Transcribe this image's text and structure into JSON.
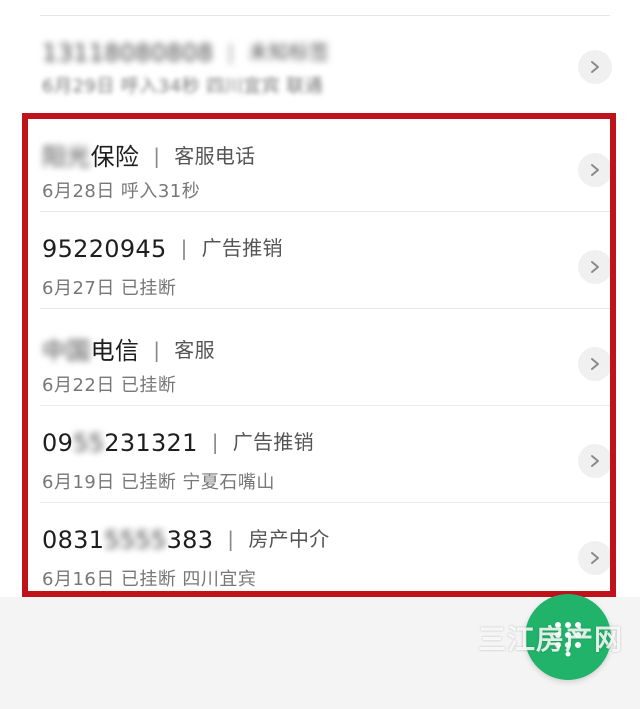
{
  "calls": [
    {
      "number": "13118080808",
      "tag": "未知标签",
      "date": "6月29日",
      "detail": "呼入34秒",
      "location": "四川宜宾",
      "carrier": "联通",
      "blurred_number": true,
      "blurred_all": true
    },
    {
      "number": "保险",
      "number_prefix_blur": "阳光",
      "tag": "客服电话",
      "date": "6月28日",
      "detail": "呼入31秒",
      "location": "",
      "carrier": ""
    },
    {
      "number": "95220945",
      "tag": "广告推销",
      "date": "6月27日",
      "detail": "已挂断",
      "location": "",
      "carrier": ""
    },
    {
      "number": "电信",
      "number_prefix_blur": "中国",
      "tag": "客服",
      "date": "6月22日",
      "detail": "已挂断",
      "location": "",
      "carrier": ""
    },
    {
      "number_visible_a": "09",
      "number_blur": "55",
      "number_visible_b": "231321",
      "tag": "广告推销",
      "date": "6月19日",
      "detail": "已挂断",
      "location": "宁夏石嘴山",
      "carrier": ""
    },
    {
      "number_visible_a": "0831",
      "number_blur": "5555",
      "number_visible_b": "383",
      "tag": "房产中介",
      "date": "6月16日",
      "detail": "已挂断",
      "location": "四川宜宾",
      "carrier": ""
    }
  ],
  "fab": {
    "icon": "dialpad-icon"
  },
  "watermark": "三江房产网",
  "colors": {
    "highlight": "#c0121b",
    "fab": "#22b36b",
    "chevron_bg": "#f0f0f0"
  }
}
